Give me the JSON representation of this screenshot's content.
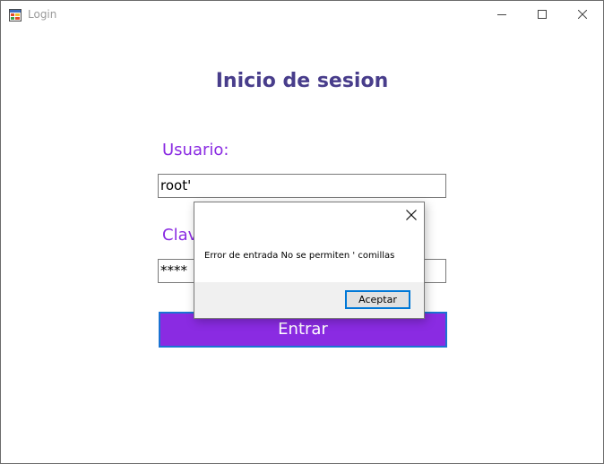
{
  "window": {
    "title": "Login"
  },
  "form": {
    "heading": "Inicio de sesion",
    "user_label": "Usuario:",
    "user_value": "root'",
    "pass_label": "Clave:",
    "pass_value": "****",
    "submit_label": "Entrar"
  },
  "dialog": {
    "message": "Error de entrada No se permiten ' comillas",
    "ok_label": "Aceptar"
  },
  "icons": {
    "app": "app-form-icon",
    "minimize": "minimize-icon",
    "maximize": "maximize-icon",
    "close": "close-icon"
  },
  "colors": {
    "heading": "#483d8b",
    "label": "#8a2be2",
    "button": "#8a2be2",
    "focus": "#0078d7"
  }
}
